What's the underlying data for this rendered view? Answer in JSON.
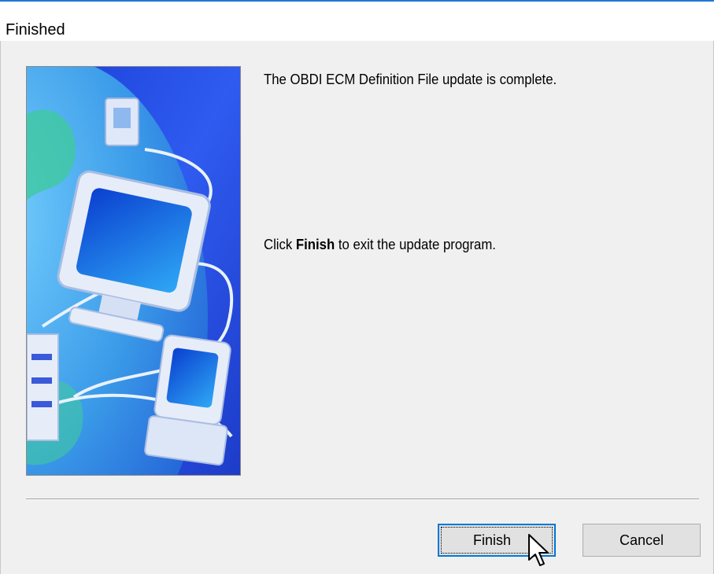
{
  "window": {
    "title": "Finished"
  },
  "content": {
    "complete_message": "The OBDI ECM Definition File update is complete.",
    "click_prefix": "Click ",
    "click_bold": "Finish",
    "click_suffix": " to exit the update program."
  },
  "buttons": {
    "finish_label": "Finish",
    "cancel_label": "Cancel"
  },
  "icons": {
    "side_art": "network-computers-illustration",
    "cursor": "mouse-pointer-arrow"
  },
  "colors": {
    "title_accent": "#1e78d6",
    "default_button_border": "#0078d7",
    "dialog_background": "#f0f0f0"
  }
}
